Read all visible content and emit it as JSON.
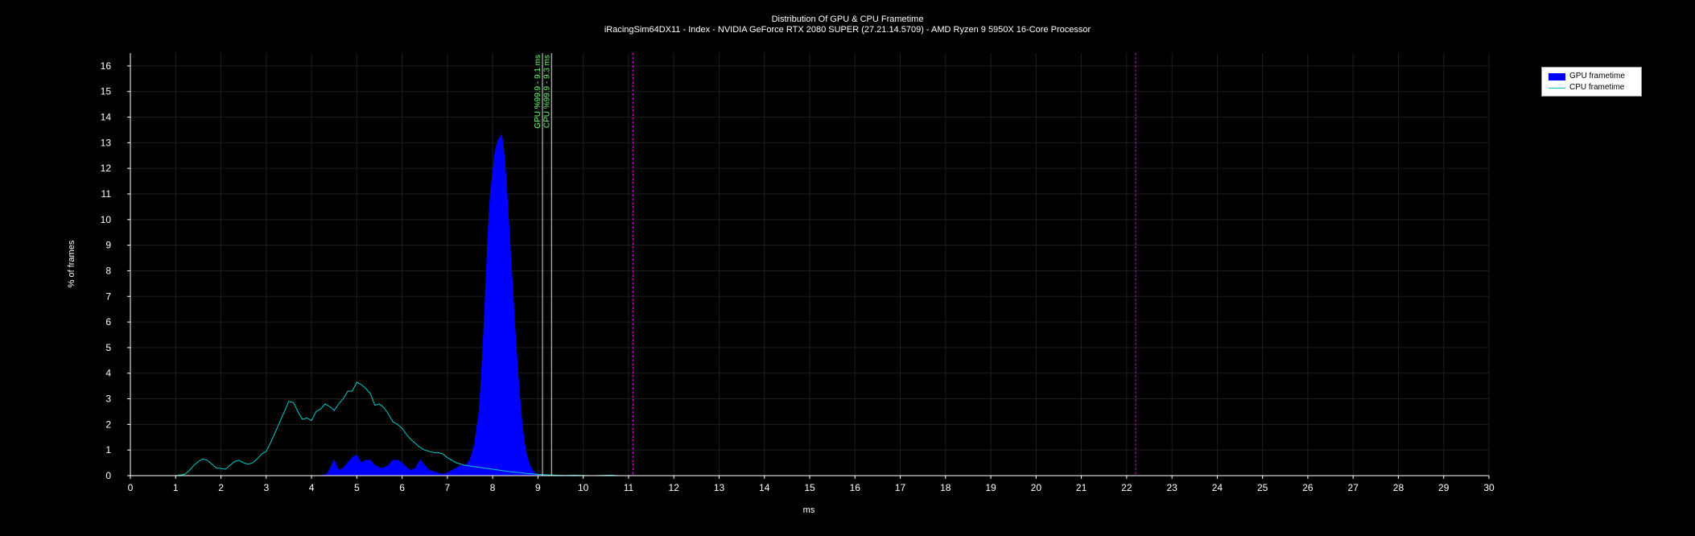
{
  "chart_data": {
    "type": "area",
    "title": "Distribution Of GPU & CPU Frametime",
    "subtitle": "iRacingSim64DX11 - Index - NVIDIA GeForce RTX 2080 SUPER (27.21.14.5709) - AMD Ryzen 9 5950X 16-Core Processor",
    "xlabel": "ms",
    "ylabel": "% of frames",
    "xlim": [
      0,
      30
    ],
    "ylim": [
      0,
      16.5
    ],
    "x_ticks": [
      0,
      1,
      2,
      3,
      4,
      5,
      6,
      7,
      8,
      9,
      10,
      11,
      12,
      13,
      14,
      15,
      16,
      17,
      18,
      19,
      20,
      21,
      22,
      23,
      24,
      25,
      26,
      27,
      28,
      29,
      30
    ],
    "y_ticks": [
      0,
      1,
      2,
      3,
      4,
      5,
      6,
      7,
      8,
      9,
      10,
      11,
      12,
      13,
      14,
      15,
      16
    ],
    "grid": true,
    "legend_position": "top-right",
    "series": [
      {
        "name": "GPU frametime",
        "style": "area",
        "color": "#0000ff",
        "x": [
          4.2,
          4.35,
          4.5,
          4.6,
          4.7,
          4.8,
          4.9,
          5.0,
          5.1,
          5.2,
          5.3,
          5.4,
          5.5,
          5.6,
          5.7,
          5.8,
          5.9,
          6.0,
          6.1,
          6.2,
          6.3,
          6.4,
          6.5,
          6.6,
          6.7,
          6.8,
          6.9,
          7.0,
          7.1,
          7.2,
          7.3,
          7.4,
          7.5,
          7.6,
          7.7,
          7.75,
          7.8,
          7.85,
          7.9,
          7.95,
          8.0,
          8.05,
          8.1,
          8.15,
          8.2,
          8.25,
          8.3,
          8.35,
          8.4,
          8.45,
          8.5,
          8.55,
          8.6,
          8.65,
          8.7,
          8.75,
          8.8,
          8.85,
          8.9,
          8.95,
          9.0,
          9.1,
          9.2,
          9.3,
          9.5,
          9.7
        ],
        "y": [
          0,
          0.05,
          0.6,
          0.2,
          0.3,
          0.5,
          0.7,
          0.8,
          0.5,
          0.6,
          0.6,
          0.4,
          0.3,
          0.3,
          0.4,
          0.6,
          0.6,
          0.5,
          0.3,
          0.2,
          0.3,
          0.6,
          0.4,
          0.2,
          0.15,
          0.1,
          0.05,
          0.1,
          0.2,
          0.3,
          0.4,
          0.4,
          0.6,
          1.2,
          2.5,
          3.8,
          5.5,
          7.5,
          9.5,
          11.0,
          11.8,
          12.6,
          13.0,
          13.2,
          13.3,
          12.6,
          11.5,
          10.0,
          8.5,
          7.0,
          5.5,
          4.2,
          3.0,
          2.0,
          1.3,
          0.8,
          0.5,
          0.3,
          0.15,
          0.08,
          0.03,
          0.02,
          0.01,
          0.02,
          0.01,
          0
        ]
      },
      {
        "name": "CPU frametime",
        "style": "line",
        "color": "#00cccc",
        "x": [
          0.5,
          1.0,
          1.2,
          1.3,
          1.4,
          1.5,
          1.6,
          1.7,
          1.8,
          1.9,
          2.0,
          2.1,
          2.2,
          2.3,
          2.4,
          2.5,
          2.6,
          2.7,
          2.8,
          2.9,
          3.0,
          3.1,
          3.2,
          3.3,
          3.4,
          3.5,
          3.6,
          3.7,
          3.8,
          3.9,
          4.0,
          4.1,
          4.2,
          4.3,
          4.4,
          4.5,
          4.6,
          4.7,
          4.8,
          4.9,
          5.0,
          5.1,
          5.2,
          5.3,
          5.4,
          5.5,
          5.6,
          5.7,
          5.8,
          5.9,
          6.0,
          6.1,
          6.2,
          6.3,
          6.4,
          6.5,
          6.6,
          6.7,
          6.8,
          6.9,
          7.0,
          7.2,
          7.4,
          7.6,
          7.8,
          8.0,
          8.2,
          8.4,
          8.6,
          8.8,
          9.0,
          9.2,
          9.4,
          9.6,
          9.8,
          10.0,
          10.2,
          10.4,
          10.6,
          10.8,
          11.0
        ],
        "y": [
          0,
          0,
          0.05,
          0.2,
          0.4,
          0.55,
          0.65,
          0.6,
          0.45,
          0.3,
          0.28,
          0.25,
          0.4,
          0.55,
          0.6,
          0.5,
          0.45,
          0.5,
          0.65,
          0.85,
          0.95,
          1.3,
          1.7,
          2.1,
          2.5,
          2.9,
          2.85,
          2.5,
          2.2,
          2.25,
          2.15,
          2.5,
          2.6,
          2.8,
          2.7,
          2.55,
          2.8,
          3.0,
          3.3,
          3.3,
          3.65,
          3.55,
          3.4,
          3.2,
          2.75,
          2.8,
          2.65,
          2.4,
          2.1,
          2.0,
          1.85,
          1.6,
          1.4,
          1.25,
          1.1,
          1.0,
          0.95,
          0.9,
          0.9,
          0.85,
          0.7,
          0.5,
          0.4,
          0.35,
          0.3,
          0.25,
          0.2,
          0.15,
          0.12,
          0.08,
          0.05,
          0.03,
          0.02,
          0.01,
          0.02,
          0.01,
          0,
          0.01,
          0.02,
          0,
          0
        ]
      }
    ],
    "markers": [
      {
        "x": 9.1,
        "label": "GPU %99.9 - 9.1 ms",
        "color": "#dddddd",
        "label_color": "#66ff66",
        "style": "solid"
      },
      {
        "x": 9.3,
        "label": "CPU %99.9 - 9.3 ms",
        "color": "#dddddd",
        "label_color": "#66ff66",
        "style": "solid"
      },
      {
        "x": 11.1,
        "label": "",
        "color": "#cc00cc",
        "style": "dashed"
      },
      {
        "x": 22.2,
        "label": "",
        "color": "#cc00cc",
        "style": "dashed"
      }
    ]
  }
}
